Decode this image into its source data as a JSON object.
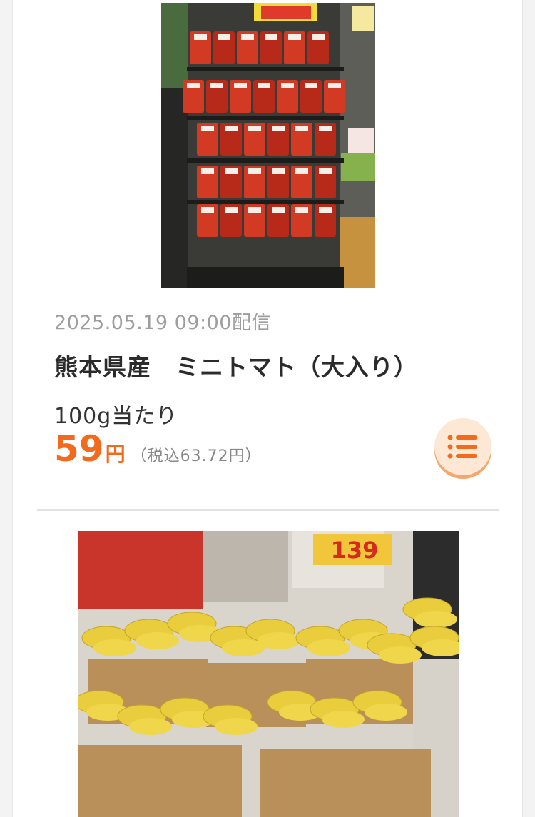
{
  "item": {
    "date": "2025.05.19 09:00配信",
    "title": "熊本県産　ミニトマト（大入り）",
    "unit": "100g当たり",
    "price": "59",
    "currency": "円",
    "tax_note": "（税込63.72円）",
    "image_alt": "ミニトマト売り場の写真",
    "menu_icon": "list-icon"
  },
  "next_item": {
    "image_alt": "バナナ売り場の写真",
    "price_tag": "139"
  },
  "colors": {
    "accent": "#f26b1d",
    "menu_bg": "#fde8d6"
  }
}
